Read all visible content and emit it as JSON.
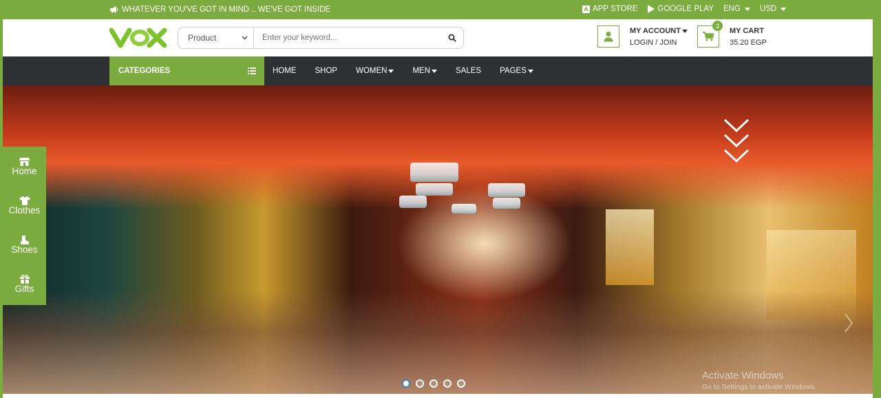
{
  "colors": {
    "accent": "#7cac3f",
    "nav_bg": "#2e3034"
  },
  "topbar": {
    "promo": "WHATEVER YOU'VE GOT IN MIND .. WE'VE GOT INSIDE",
    "app_store": "APP STORE",
    "google_play": "GOOGLE PLAY",
    "language": "ENG",
    "currency": "USD"
  },
  "header": {
    "logo_alt": "VOX",
    "search": {
      "category": "Product",
      "placeholder": "Enter your keyword..."
    },
    "account": {
      "title": "MY ACCOUNT",
      "sub": "LOGIN / JOIN"
    },
    "cart": {
      "title": "MY CART",
      "amount": "35.20 EGP",
      "count": "3"
    }
  },
  "nav": {
    "categories": "CATEGORIES",
    "items": [
      {
        "label": "HOME",
        "dropdown": false
      },
      {
        "label": "SHOP",
        "dropdown": false
      },
      {
        "label": "WOMEN",
        "dropdown": true
      },
      {
        "label": "MEN",
        "dropdown": true
      },
      {
        "label": "SALES",
        "dropdown": false
      },
      {
        "label": "PAGES",
        "dropdown": true
      }
    ]
  },
  "sidebar": {
    "items": [
      {
        "label": "Home",
        "icon": "store-icon"
      },
      {
        "label": "Clothes",
        "icon": "tshirt-icon"
      },
      {
        "label": "Shoes",
        "icon": "boot-icon"
      },
      {
        "label": "Gifts",
        "icon": "gift-icon"
      }
    ]
  },
  "slider": {
    "slide_count": 5,
    "active_index": 0
  },
  "watermark": {
    "title": "Activate Windows",
    "sub": "Go to Settings to activate Windows."
  }
}
